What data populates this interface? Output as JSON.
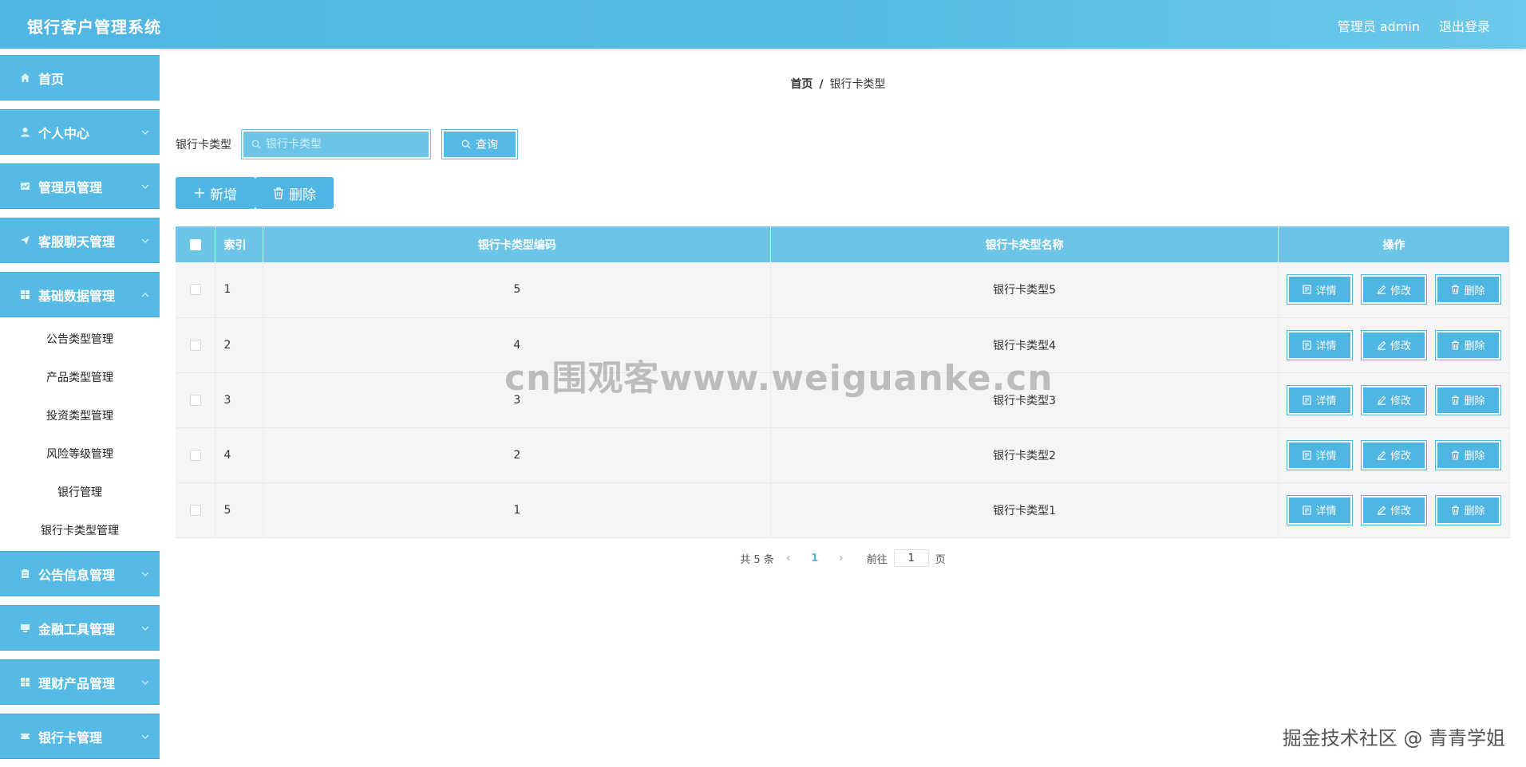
{
  "header": {
    "title": "银行客户管理系统",
    "user_label": "管理员 admin",
    "logout_label": "退出登录"
  },
  "sidebar": {
    "menus": [
      {
        "label": "首页",
        "icon": "home-icon"
      },
      {
        "label": "个人中心",
        "icon": "user-icon"
      },
      {
        "label": "管理员管理",
        "icon": "chart-icon"
      },
      {
        "label": "客服聊天管理",
        "icon": "send-icon"
      },
      {
        "label": "基础数据管理",
        "icon": "grid-icon"
      },
      {
        "label": "公告信息管理",
        "icon": "clipboard-icon"
      },
      {
        "label": "金融工具管理",
        "icon": "monitor-icon"
      },
      {
        "label": "理财产品管理",
        "icon": "grid-icon"
      },
      {
        "label": "银行卡管理",
        "icon": "ticket-icon"
      }
    ],
    "sub_items": [
      "公告类型管理",
      "产品类型管理",
      "投资类型管理",
      "风险等级管理",
      "银行管理",
      "银行卡类型管理"
    ]
  },
  "breadcrumb": {
    "home": "首页",
    "separator": "/",
    "current": "银行卡类型"
  },
  "search": {
    "label": "银行卡类型",
    "placeholder": "银行卡类型",
    "query_label": "查询"
  },
  "actions": {
    "add_label": "新增",
    "delete_label": "删除"
  },
  "table": {
    "headers": {
      "index": "索引",
      "code": "银行卡类型编码",
      "name": "银行卡类型名称",
      "ops": "操作"
    },
    "row_buttons": {
      "detail": "详情",
      "edit": "修改",
      "delete": "删除"
    },
    "rows": [
      {
        "index": "1",
        "code": "5",
        "name": "银行卡类型5"
      },
      {
        "index": "2",
        "code": "4",
        "name": "银行卡类型4"
      },
      {
        "index": "3",
        "code": "3",
        "name": "银行卡类型3"
      },
      {
        "index": "4",
        "code": "2",
        "name": "银行卡类型2"
      },
      {
        "index": "5",
        "code": "1",
        "name": "银行卡类型1"
      }
    ]
  },
  "pagination": {
    "total_text": "共 5 条",
    "current_page": "1",
    "goto_prefix": "前往",
    "goto_value": "1",
    "goto_suffix": "页"
  },
  "overlays": {
    "watermark": "cn围观客www.weiguanke.cn",
    "corner": "掘金技术社区 @ 青青学姐"
  },
  "colors": {
    "accent": "#55bbe6",
    "header_bg": "#56bde6",
    "table_header": "#6cc4e6"
  }
}
